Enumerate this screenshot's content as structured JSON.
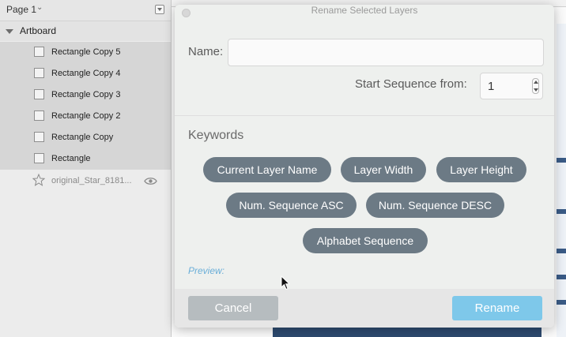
{
  "sidebar": {
    "page_label": "Page 1",
    "artboard_label": "Artboard",
    "layers": [
      {
        "label": "Rectangle Copy 5"
      },
      {
        "label": "Rectangle Copy 4"
      },
      {
        "label": "Rectangle Copy 3"
      },
      {
        "label": "Rectangle Copy 2"
      },
      {
        "label": "Rectangle Copy"
      },
      {
        "label": "Rectangle"
      }
    ],
    "star_layer_label": "original_Star_8181..."
  },
  "dialog": {
    "title": "Rename Selected Layers",
    "name_label": "Name:",
    "name_value": "",
    "start_sequence_label": "Start Sequence from:",
    "start_sequence_value": "1",
    "keywords_title": "Keywords",
    "keywords": [
      "Current Layer Name",
      "Layer Width",
      "Layer Height",
      "Num. Sequence ASC",
      "Num. Sequence DESC",
      "Alphabet Sequence"
    ],
    "preview_label": "Preview:",
    "cancel_label": "Cancel",
    "rename_label": "Rename"
  },
  "colors": {
    "keyword_pill": "#6c7a85",
    "rename_button": "#7ec8ea",
    "cancel_button": "#b6bcbf",
    "preview_text": "#6aaed8"
  }
}
